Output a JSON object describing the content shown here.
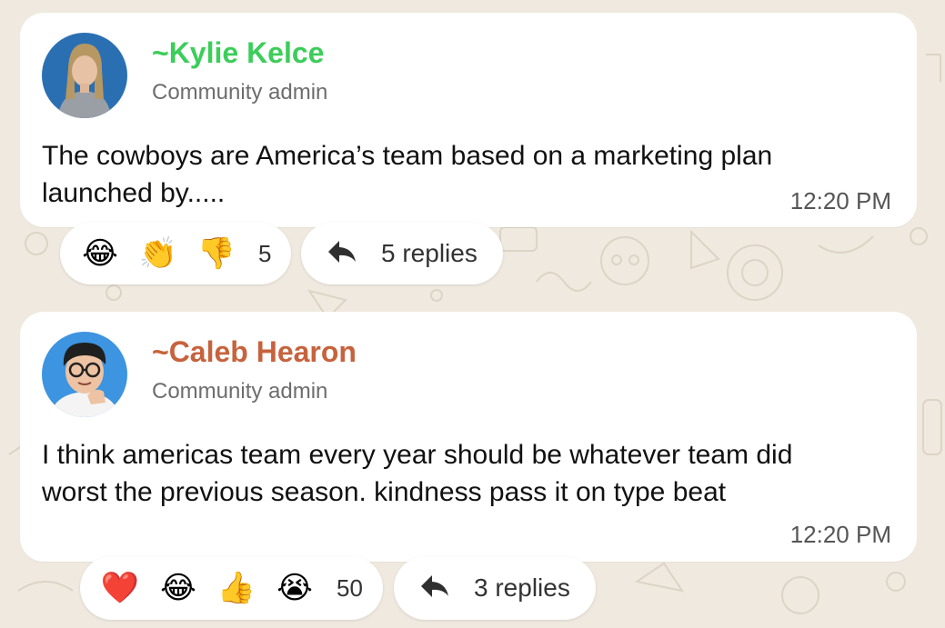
{
  "colors": {
    "background": "#efe9df",
    "bubble": "#ffffff",
    "sender1": "#3ccd5a",
    "sender2": "#c6633d"
  },
  "messages": [
    {
      "sender": "~Kylie Kelce",
      "role": "Community admin",
      "text": "The cowboys are America’s team based on a marketing plan launched by.....",
      "time": "12:20 PM",
      "reactions": {
        "emojis": [
          {
            "name": "laughing-face-icon",
            "glyph": "😂"
          },
          {
            "name": "clapping-hands-icon",
            "glyph": "👏"
          },
          {
            "name": "thumbs-down-icon",
            "glyph": "👎"
          }
        ],
        "count": "5"
      },
      "replies_label": "5 replies"
    },
    {
      "sender": "~Caleb Hearon",
      "role": "Community admin",
      "text": "I think americas team every year should be whatever team did worst the previous season. kindness pass it on type beat",
      "time": "12:20 PM",
      "reactions": {
        "emojis": [
          {
            "name": "heart-icon",
            "glyph": "❤️"
          },
          {
            "name": "laughing-face-icon",
            "glyph": "😂"
          },
          {
            "name": "thumbs-up-icon",
            "glyph": "👍"
          },
          {
            "name": "crying-face-icon",
            "glyph": "😭"
          }
        ],
        "count": "50"
      },
      "replies_label": "3 replies"
    }
  ]
}
